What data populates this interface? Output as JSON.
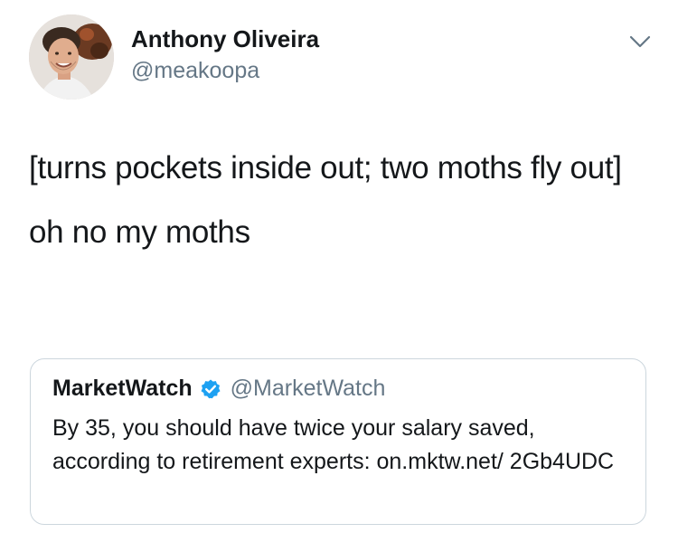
{
  "tweet": {
    "author_name": "Anthony Oliveira",
    "author_handle": "@meakoopa",
    "avatar_icon": "profile-photo",
    "menu_icon": "chevron-down-icon",
    "text_para1": "[turns pockets inside out; two moths fly out]",
    "text_para2": "oh no my moths"
  },
  "quoted_tweet": {
    "author_name": "MarketWatch",
    "verified_icon": "verified-badge-icon",
    "author_handle": "@MarketWatch",
    "text": "By 35, you should have twice your salary saved, according to retirement experts: on.mktw.net/ 2Gb4UDC"
  },
  "colors": {
    "primary_text": "#14171a",
    "secondary_text": "#657786",
    "border": "#ccd6dd",
    "verified_blue": "#1da1f2"
  }
}
